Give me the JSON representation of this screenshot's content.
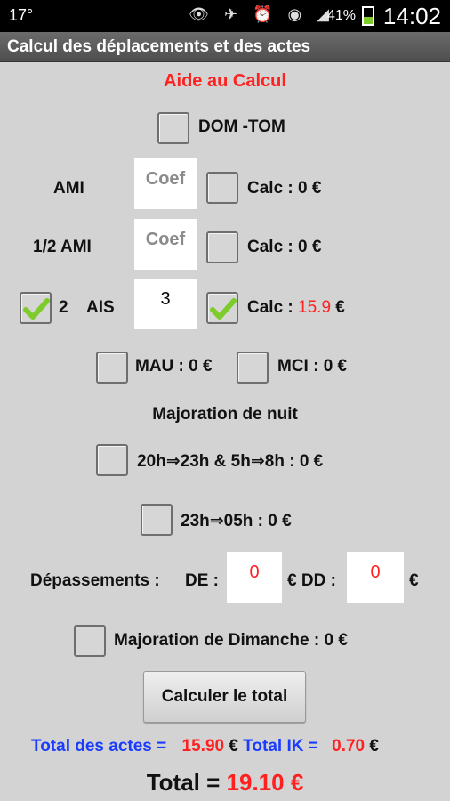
{
  "status": {
    "left": "17°",
    "icons": "👁 ✈ ⏰ ◉ ◢",
    "battery_pct": "41%",
    "time": "14:02"
  },
  "app": {
    "title": "Calcul des déplacements et des actes"
  },
  "heading": "Aide au Calcul",
  "dom_tom": {
    "label": "DOM -TOM",
    "checked": false
  },
  "ami": {
    "label": "AMI",
    "coef_placeholder": "Coef",
    "calc_label": "Calc : 0 €",
    "checked": false
  },
  "half_ami": {
    "label": "1/2 AMI",
    "coef_placeholder": "Coef",
    "calc_label": "Calc : 0 €",
    "checked": false
  },
  "ais": {
    "num": "2",
    "label": "AIS",
    "value": "3",
    "calc_prefix": "Calc :",
    "calc_value": "15.9",
    "calc_suffix": "€",
    "left_checked": true,
    "calc_checked": true
  },
  "mau": {
    "label": "MAU :  0 €",
    "checked": false
  },
  "mci": {
    "label": "MCI :  0 €",
    "checked": false
  },
  "night": {
    "title": "Majoration de nuit",
    "option1": "20h⇒23h & 5h⇒8h :  0 €",
    "option2": "23h⇒05h :  0 €"
  },
  "depassements": {
    "label": "Dépassements :",
    "de_label": "DE :",
    "de_value": "0",
    "dd_label": "€ DD :",
    "dd_value": "0",
    "end_currency": "€"
  },
  "dimanche": {
    "label": "Majoration de Dimanche :  0 €"
  },
  "button": {
    "label": "Calculer le total"
  },
  "totals": {
    "actes_label": "Total des actes =",
    "actes_value": "15.90",
    "actes_currency": "€",
    "ik_label": "Total IK =",
    "ik_value": "0.70",
    "ik_currency": "€",
    "total_label": "Total =",
    "total_value": "19.10 €"
  },
  "colors": {
    "accent_red": "#ff2020",
    "accent_blue": "#1a3cff",
    "check_green": "#7ecb2c"
  }
}
